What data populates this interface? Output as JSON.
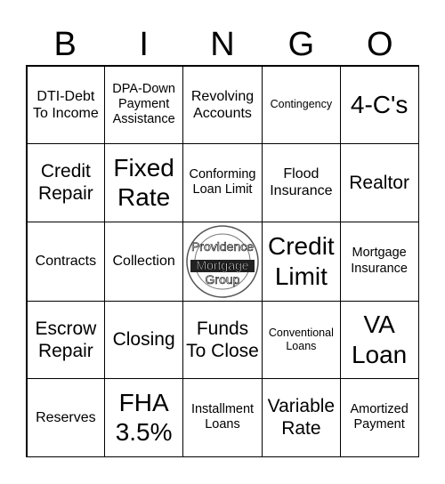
{
  "header": [
    "B",
    "I",
    "N",
    "G",
    "O"
  ],
  "cells": [
    "DTI-Debt To Income",
    "DPA-Down Payment Assistance",
    "Revolving Accounts",
    "Contingency",
    "4-C's",
    "Credit Repair",
    "Fixed Rate",
    "Conforming Loan Limit",
    "Flood Insurance",
    "Realtor",
    "Contracts",
    "Collection",
    "",
    "Credit Limit",
    "Mortgage Insurance",
    "Escrow Repair",
    "Closing",
    "Funds To Close",
    "Conventional Loans",
    "VA Loan",
    "Reserves",
    "FHA 3.5%",
    "Installment Loans",
    "Variable Rate",
    "Amortized Payment"
  ],
  "free_space": {
    "logo_text": [
      "Providence",
      "Mortgage",
      "Group"
    ]
  }
}
